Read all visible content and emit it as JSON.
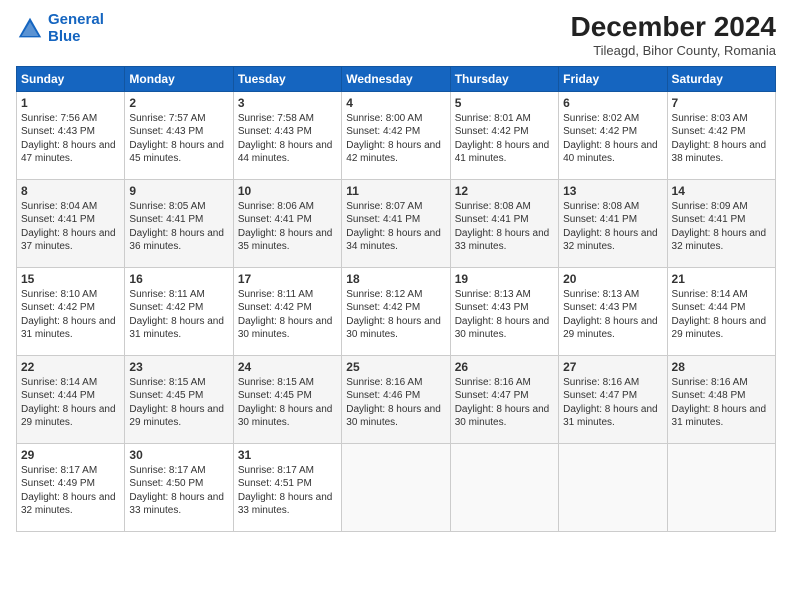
{
  "logo": {
    "line1": "General",
    "line2": "Blue"
  },
  "title": "December 2024",
  "subtitle": "Tileagd, Bihor County, Romania",
  "days_of_week": [
    "Sunday",
    "Monday",
    "Tuesday",
    "Wednesday",
    "Thursday",
    "Friday",
    "Saturday"
  ],
  "weeks": [
    [
      {
        "day": 1,
        "sunrise": "7:56 AM",
        "sunset": "4:43 PM",
        "daylight": "8 hours and 47 minutes."
      },
      {
        "day": 2,
        "sunrise": "7:57 AM",
        "sunset": "4:43 PM",
        "daylight": "8 hours and 45 minutes."
      },
      {
        "day": 3,
        "sunrise": "7:58 AM",
        "sunset": "4:43 PM",
        "daylight": "8 hours and 44 minutes."
      },
      {
        "day": 4,
        "sunrise": "8:00 AM",
        "sunset": "4:42 PM",
        "daylight": "8 hours and 42 minutes."
      },
      {
        "day": 5,
        "sunrise": "8:01 AM",
        "sunset": "4:42 PM",
        "daylight": "8 hours and 41 minutes."
      },
      {
        "day": 6,
        "sunrise": "8:02 AM",
        "sunset": "4:42 PM",
        "daylight": "8 hours and 40 minutes."
      },
      {
        "day": 7,
        "sunrise": "8:03 AM",
        "sunset": "4:42 PM",
        "daylight": "8 hours and 38 minutes."
      }
    ],
    [
      {
        "day": 8,
        "sunrise": "8:04 AM",
        "sunset": "4:41 PM",
        "daylight": "8 hours and 37 minutes."
      },
      {
        "day": 9,
        "sunrise": "8:05 AM",
        "sunset": "4:41 PM",
        "daylight": "8 hours and 36 minutes."
      },
      {
        "day": 10,
        "sunrise": "8:06 AM",
        "sunset": "4:41 PM",
        "daylight": "8 hours and 35 minutes."
      },
      {
        "day": 11,
        "sunrise": "8:07 AM",
        "sunset": "4:41 PM",
        "daylight": "8 hours and 34 minutes."
      },
      {
        "day": 12,
        "sunrise": "8:08 AM",
        "sunset": "4:41 PM",
        "daylight": "8 hours and 33 minutes."
      },
      {
        "day": 13,
        "sunrise": "8:08 AM",
        "sunset": "4:41 PM",
        "daylight": "8 hours and 32 minutes."
      },
      {
        "day": 14,
        "sunrise": "8:09 AM",
        "sunset": "4:41 PM",
        "daylight": "8 hours and 32 minutes."
      }
    ],
    [
      {
        "day": 15,
        "sunrise": "8:10 AM",
        "sunset": "4:42 PM",
        "daylight": "8 hours and 31 minutes."
      },
      {
        "day": 16,
        "sunrise": "8:11 AM",
        "sunset": "4:42 PM",
        "daylight": "8 hours and 31 minutes."
      },
      {
        "day": 17,
        "sunrise": "8:11 AM",
        "sunset": "4:42 PM",
        "daylight": "8 hours and 30 minutes."
      },
      {
        "day": 18,
        "sunrise": "8:12 AM",
        "sunset": "4:42 PM",
        "daylight": "8 hours and 30 minutes."
      },
      {
        "day": 19,
        "sunrise": "8:13 AM",
        "sunset": "4:43 PM",
        "daylight": "8 hours and 30 minutes."
      },
      {
        "day": 20,
        "sunrise": "8:13 AM",
        "sunset": "4:43 PM",
        "daylight": "8 hours and 29 minutes."
      },
      {
        "day": 21,
        "sunrise": "8:14 AM",
        "sunset": "4:44 PM",
        "daylight": "8 hours and 29 minutes."
      }
    ],
    [
      {
        "day": 22,
        "sunrise": "8:14 AM",
        "sunset": "4:44 PM",
        "daylight": "8 hours and 29 minutes."
      },
      {
        "day": 23,
        "sunrise": "8:15 AM",
        "sunset": "4:45 PM",
        "daylight": "8 hours and 29 minutes."
      },
      {
        "day": 24,
        "sunrise": "8:15 AM",
        "sunset": "4:45 PM",
        "daylight": "8 hours and 30 minutes."
      },
      {
        "day": 25,
        "sunrise": "8:16 AM",
        "sunset": "4:46 PM",
        "daylight": "8 hours and 30 minutes."
      },
      {
        "day": 26,
        "sunrise": "8:16 AM",
        "sunset": "4:47 PM",
        "daylight": "8 hours and 30 minutes."
      },
      {
        "day": 27,
        "sunrise": "8:16 AM",
        "sunset": "4:47 PM",
        "daylight": "8 hours and 31 minutes."
      },
      {
        "day": 28,
        "sunrise": "8:16 AM",
        "sunset": "4:48 PM",
        "daylight": "8 hours and 31 minutes."
      }
    ],
    [
      {
        "day": 29,
        "sunrise": "8:17 AM",
        "sunset": "4:49 PM",
        "daylight": "8 hours and 32 minutes."
      },
      {
        "day": 30,
        "sunrise": "8:17 AM",
        "sunset": "4:50 PM",
        "daylight": "8 hours and 33 minutes."
      },
      {
        "day": 31,
        "sunrise": "8:17 AM",
        "sunset": "4:51 PM",
        "daylight": "8 hours and 33 minutes."
      },
      null,
      null,
      null,
      null
    ]
  ]
}
